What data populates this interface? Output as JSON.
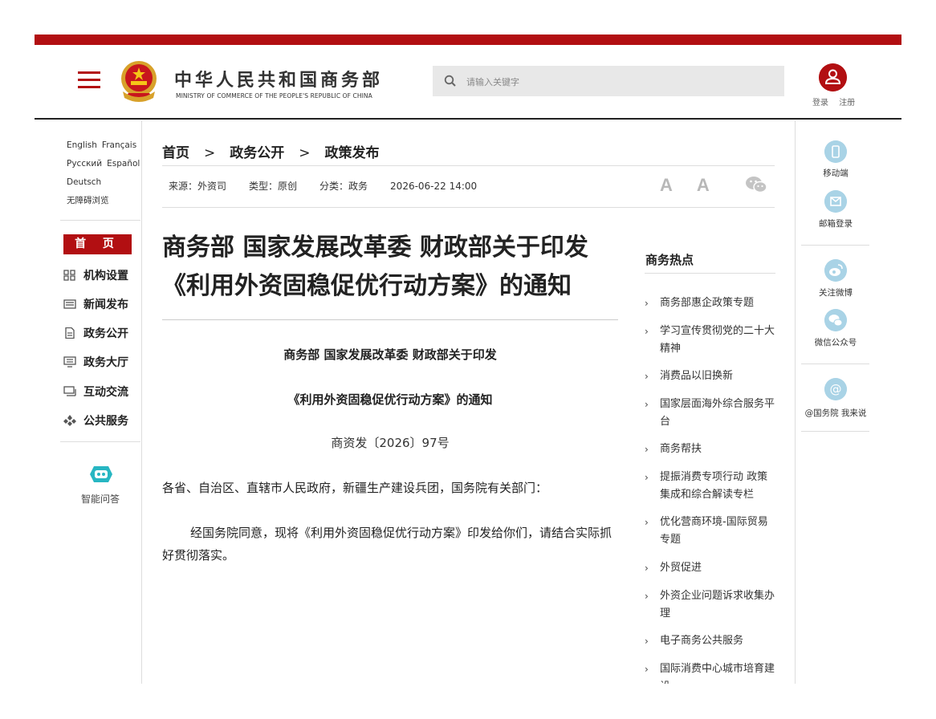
{
  "header": {
    "title_cn": "中华人民共和国商务部",
    "title_en": "MINISTRY OF COMMERCE OF THE PEOPLE'S REPUBLIC OF CHINA",
    "search_placeholder": "请输入关键字",
    "login": "登录",
    "register": "注册",
    "brand_color": "#b20f12"
  },
  "sidebar": {
    "languages": [
      "English",
      "Français",
      "Русский",
      "Español",
      "Deutsch",
      "无障碍浏览"
    ],
    "home": "首 页",
    "items": [
      {
        "label": "机构设置",
        "icon": "grid-icon"
      },
      {
        "label": "新闻发布",
        "icon": "newspaper-icon"
      },
      {
        "label": "政务公开",
        "icon": "document-icon"
      },
      {
        "label": "政务大厅",
        "icon": "monitor-icon"
      },
      {
        "label": "互动交流",
        "icon": "chat-icon"
      },
      {
        "label": "公共服务",
        "icon": "service-icon"
      }
    ],
    "ai_label": "智能问答"
  },
  "breadcrumb": [
    "首页",
    "政务公开",
    "政策发布"
  ],
  "breadcrumb_sep": ">",
  "meta": {
    "source": "来源：外资司",
    "type": "类型：原创",
    "category": "分类：政务",
    "datetime": "2026-06-22 14:00"
  },
  "font_controls": {
    "larger": "A",
    "smaller": "A"
  },
  "article": {
    "title_line1": "商务部 国家发展改革委 财政部关于印发",
    "title_line2": "《利用外资固稳促优行动方案》的通知",
    "doc_head1": "商务部 国家发展改革委 财政部关于印发",
    "doc_head2": "《利用外资固稳促优行动方案》的通知",
    "doc_number": "商资发〔2026〕97号",
    "para1": "各省、自治区、直辖市人民政府，新疆生产建设兵团，国务院有关部门：",
    "para2": "经国务院同意，现将《利用外资固稳促优行动方案》印发给你们，请结合实际抓好贯彻落实。"
  },
  "hot": {
    "title": "商务热点",
    "items": [
      "商务部惠企政策专题",
      "学习宣传贯彻党的二十大精神",
      "消费品以旧换新",
      "国家层面海外综合服务平台",
      "商务帮扶",
      "提振消费专项行动 政策集成和综合解读专栏",
      "优化营商环境-国际贸易专题",
      "外贸促进",
      "外资企业问题诉求收集办理",
      "电子商务公共服务",
      "国际消费中心城市培育建设"
    ]
  },
  "right": {
    "mobile": "移动端",
    "mail": "邮箱登录",
    "weibo": "关注微博",
    "wechat": "微信公众号",
    "at_gov": "@国务院 我来说",
    "icon_color": "#a9d3e6"
  }
}
